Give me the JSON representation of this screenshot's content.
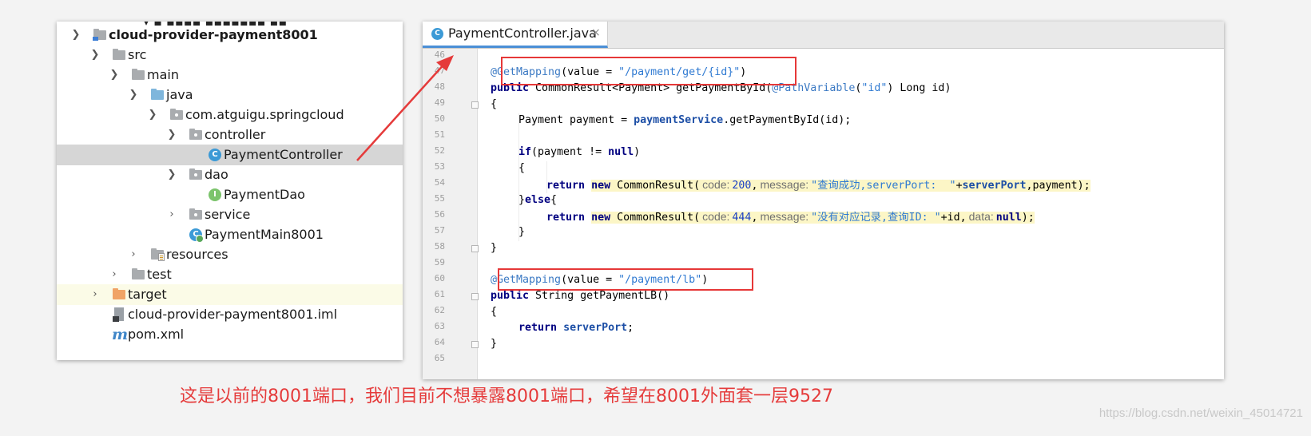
{
  "project_tree": {
    "rows": [
      {
        "label": "cloud-provider-payment8001",
        "chevron": "down",
        "icon": "module-folder-icon"
      },
      {
        "label": "src",
        "chevron": "down",
        "icon": "folder-icon"
      },
      {
        "label": "main",
        "chevron": "down",
        "icon": "folder-icon"
      },
      {
        "label": "java",
        "chevron": "down",
        "icon": "source-folder-icon"
      },
      {
        "label": "com.atguigu.springcloud",
        "chevron": "down",
        "icon": "package-icon"
      },
      {
        "label": "controller",
        "chevron": "down",
        "icon": "package-icon"
      },
      {
        "label": "PaymentController",
        "chevron": "",
        "icon": "class-icon",
        "icon_letter": "C"
      },
      {
        "label": "dao",
        "chevron": "down",
        "icon": "package-icon"
      },
      {
        "label": "PaymentDao",
        "chevron": "",
        "icon": "interface-icon",
        "icon_letter": "I"
      },
      {
        "label": "service",
        "chevron": "right",
        "icon": "package-icon"
      },
      {
        "label": "PaymentMain8001",
        "chevron": "",
        "icon": "main-class-icon",
        "icon_letter": "C"
      },
      {
        "label": "resources",
        "chevron": "right",
        "icon": "resources-folder-icon"
      },
      {
        "label": "test",
        "chevron": "right",
        "icon": "folder-icon"
      },
      {
        "label": "target",
        "chevron": "right",
        "icon": "excluded-folder-icon"
      },
      {
        "label": "cloud-provider-payment8001.iml",
        "chevron": "",
        "icon": "iml-file-icon"
      },
      {
        "label": "pom.xml",
        "chevron": "",
        "icon": "maven-icon",
        "icon_letter": "m"
      }
    ],
    "selected": "PaymentController"
  },
  "editor": {
    "tab": {
      "label": "PaymentController.java",
      "icon_letter": "C",
      "close_glyph": "×"
    },
    "line_numbers": [
      "46",
      "47",
      "48",
      "49",
      "50",
      "51",
      "52",
      "53",
      "54",
      "55",
      "56",
      "57",
      "58",
      "59",
      "60",
      "61",
      "62",
      "63",
      "64",
      "65"
    ],
    "code": {
      "l47_anno": "@GetMapping",
      "l47_rest": "(value = ",
      "l47_str": "\"/payment/get/{id}\"",
      "l47_close": ")",
      "l48_kw": "public",
      "l48_type": " CommonResult<Payment> getPaymentById(",
      "l48_anno": "@PathVariable",
      "l48_p1": "(",
      "l48_str": "\"id\"",
      "l48_p2": ") Long id)",
      "l49": "{",
      "l50_a": "Payment payment = ",
      "l50_field": "paymentService",
      "l50_b": ".getPaymentById(id);",
      "l52_kw": "if",
      "l52_a": "(payment != ",
      "l52_null": "null",
      "l52_b": ")",
      "l53": "{",
      "l54_return": "return",
      "l54_new": "new",
      "l54_type": " CommonResult(",
      "l54_hint1": "code:",
      "l54_num": "200",
      "l54_comma": ",",
      "l54_hint2": "message:",
      "l54_str": "\"查询成功,serverPort:  \"",
      "l54_plus": "+",
      "l54_field": "serverPort",
      "l54_end": ",payment);",
      "l55_a": "}",
      "l55_else": "else",
      "l55_b": "{",
      "l56_return": "return",
      "l56_new": "new",
      "l56_type": " CommonResult(",
      "l56_hint1": "code:",
      "l56_num": "444",
      "l56_comma": ",",
      "l56_hint2": "message:",
      "l56_str": "\"没有对应记录,查询ID: \"",
      "l56_plus": "+id,",
      "l56_hint3": "data:",
      "l56_null": "null",
      "l56_end": ");",
      "l57": "}",
      "l58": "}",
      "l60_anno": "@GetMapping",
      "l60_rest": "(value = ",
      "l60_str": "\"/payment/lb\"",
      "l60_close": ")",
      "l61_kw": "public",
      "l61_rest": " String getPaymentLB()",
      "l62": "{",
      "l63_kw": "return",
      "l63_field": "serverPort",
      "l63_end": ";",
      "l64": "}"
    }
  },
  "caption": "这是以前的8001端口，我们目前不想暴露8001端口，希望在8001外面套一层9527",
  "watermark": "https://blog.csdn.net/weixin_45014721",
  "colors": {
    "highlight_red": "#e63838",
    "caption_red": "#e53b3b",
    "selection": "#d6d6d6"
  }
}
